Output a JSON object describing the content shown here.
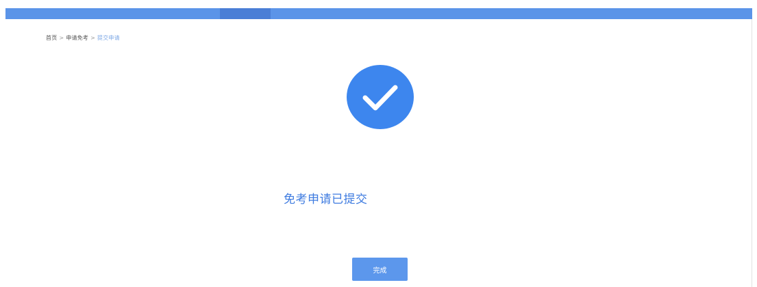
{
  "top_nav": {
    "color": "#5b94e8",
    "active_color": "#4a7ed6"
  },
  "breadcrumb": {
    "items": [
      "首页",
      "申请免考",
      "提交申请"
    ],
    "separator": ">"
  },
  "result": {
    "icon": "check-circle-icon",
    "icon_color": "#3d86ee",
    "message": "免考申请已提交"
  },
  "actions": {
    "done_label": "完成"
  }
}
